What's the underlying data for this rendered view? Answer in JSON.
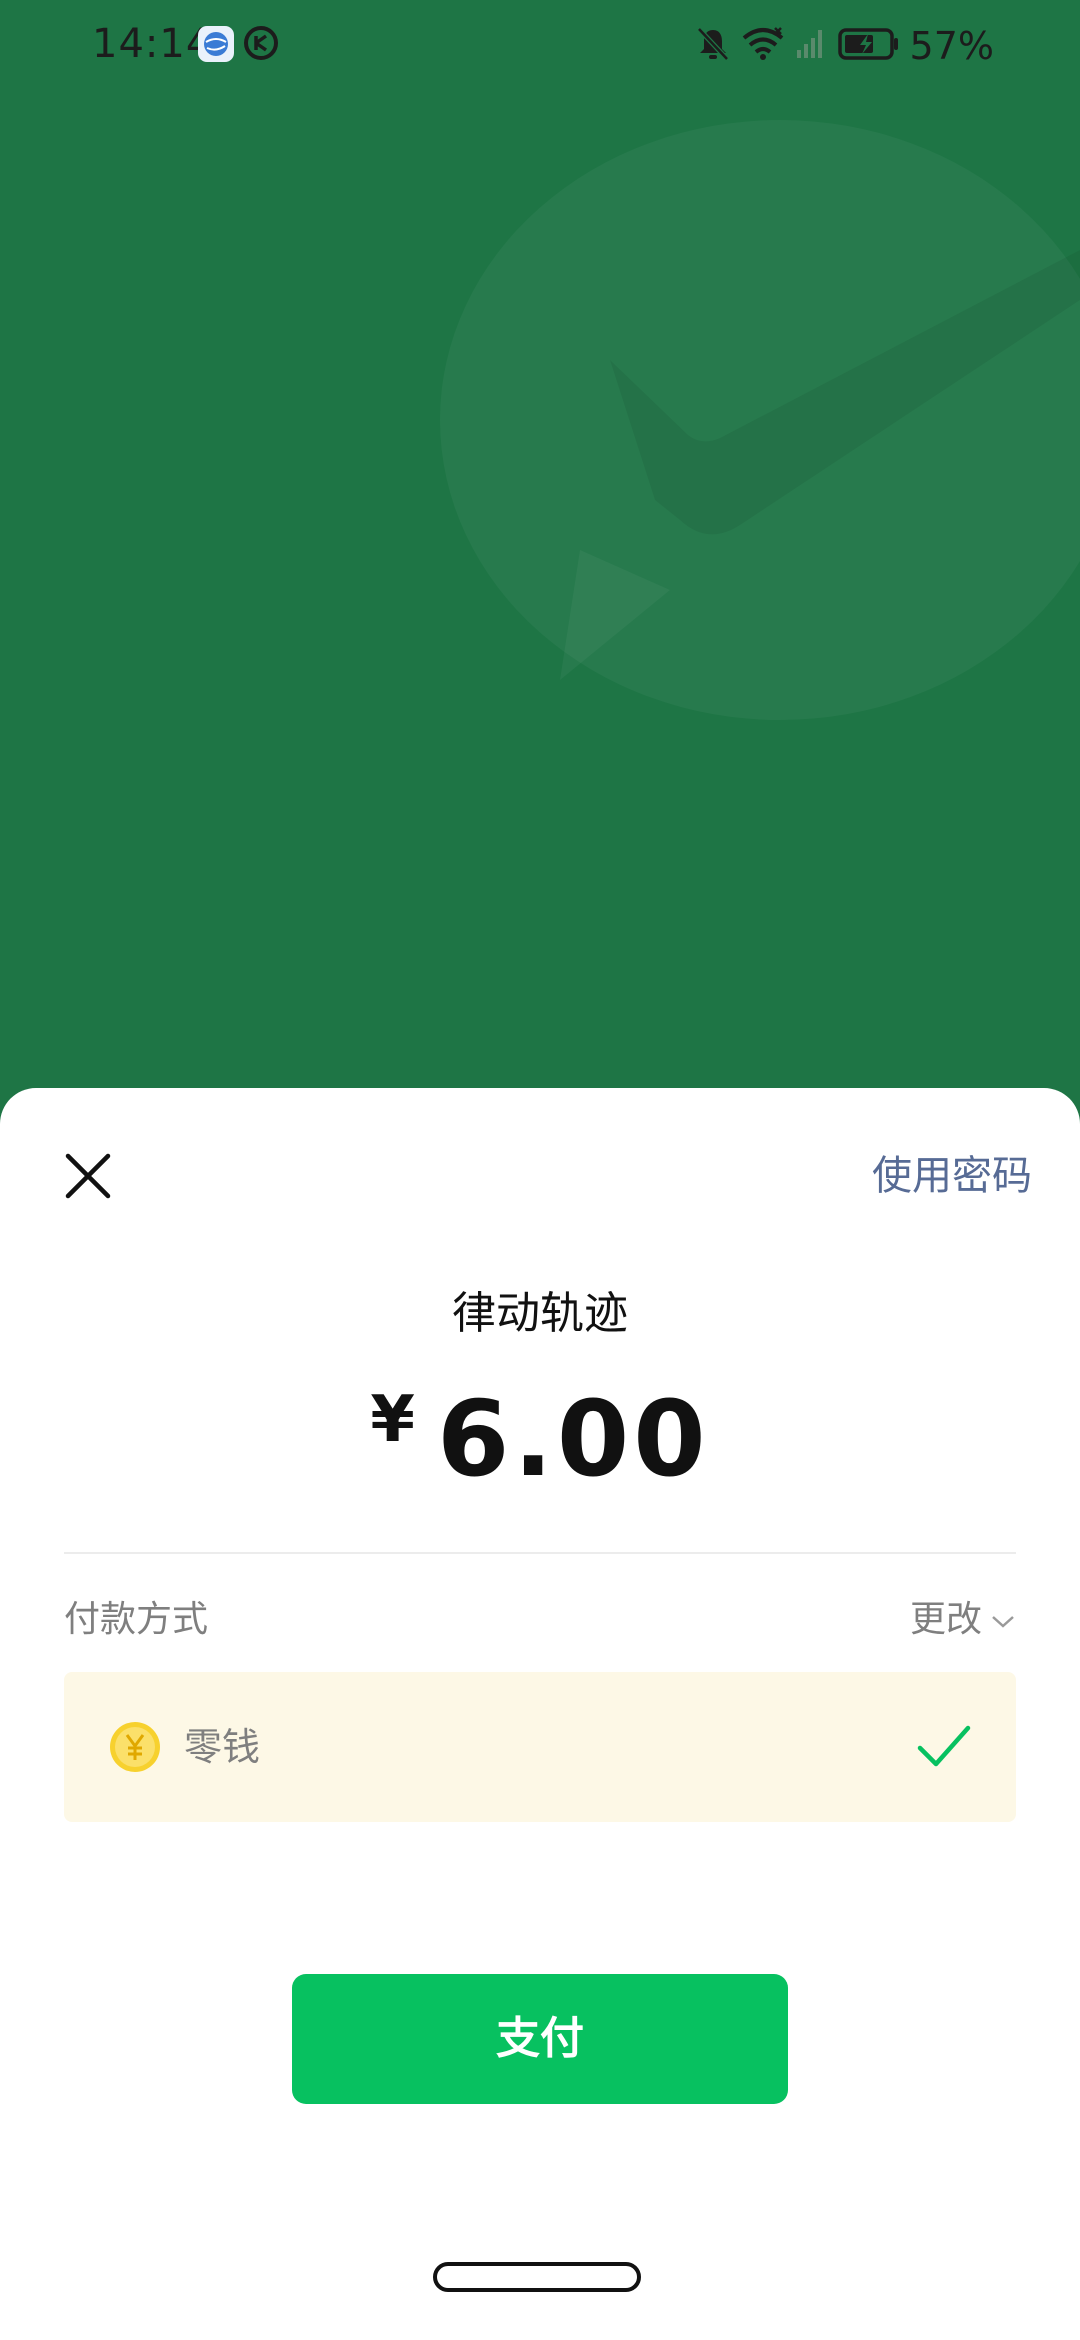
{
  "status_bar": {
    "time": "14:14",
    "battery_text": "57%",
    "icons": [
      "browser-app-icon",
      "app-notification-icon",
      "bell-muted-icon",
      "wifi-icon",
      "signal-icon",
      "battery-charging-icon"
    ]
  },
  "background": {
    "color": "#1e7545",
    "logo_icon": "wechat-pay-logo-icon"
  },
  "sheet": {
    "close_icon": "close-icon",
    "use_password_label": "使用密码",
    "merchant_name": "律动轨迹",
    "currency_symbol": "¥",
    "amount": "6.00",
    "payment_method_label": "付款方式",
    "change_label": "更改",
    "selected_method": {
      "name": "零钱",
      "icon": "coin-icon",
      "selected_icon": "checkmark-icon"
    },
    "pay_button_label": "支付"
  },
  "colors": {
    "link": "#576b95",
    "primary": "#07c160",
    "method_row_bg": "#fdf8e6"
  }
}
